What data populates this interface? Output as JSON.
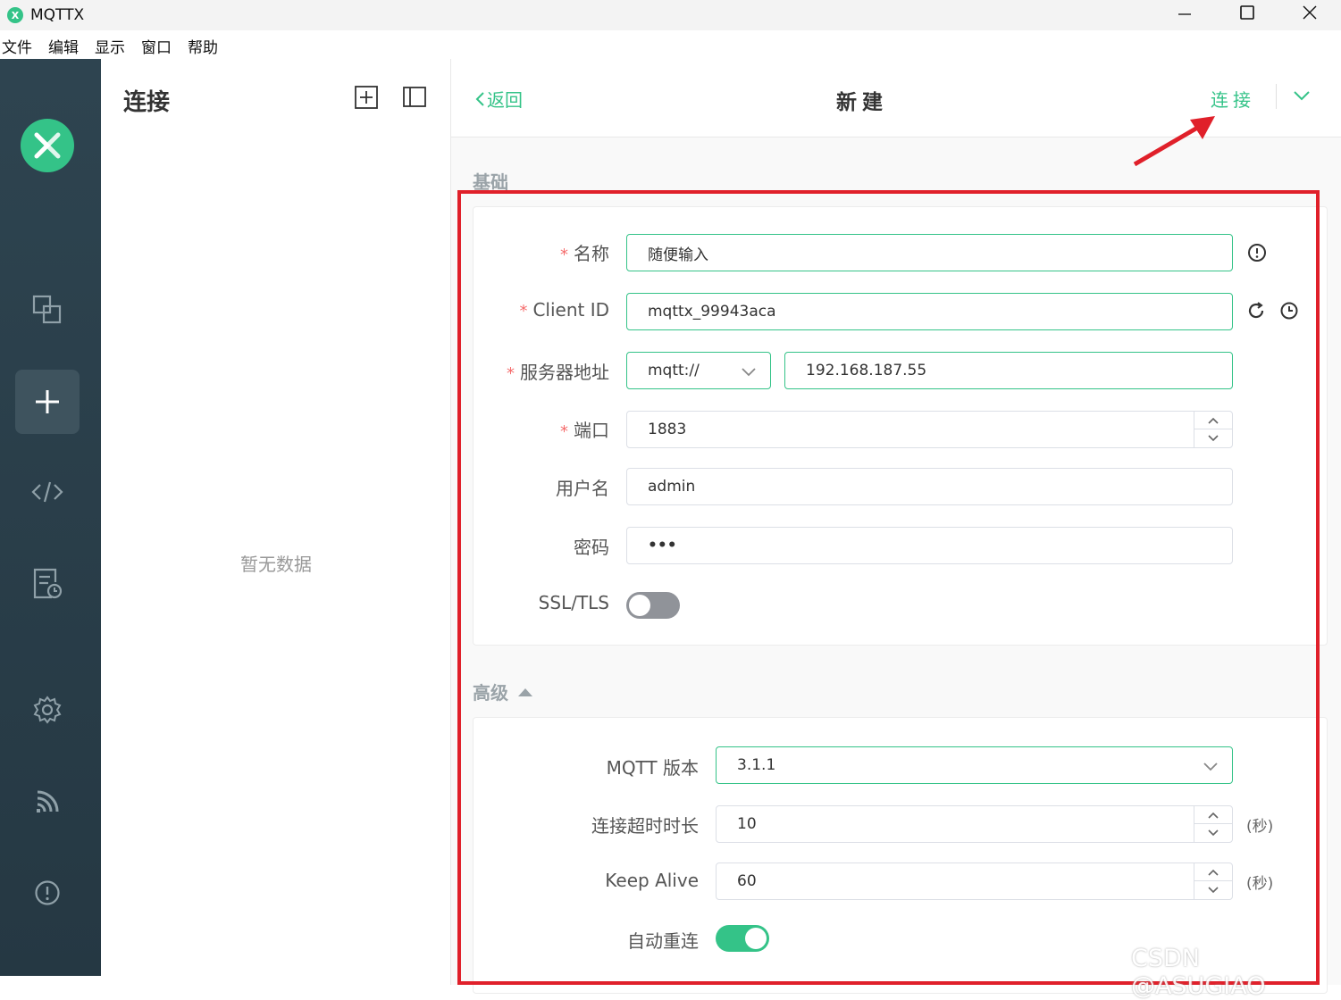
{
  "window": {
    "app_title": "MQTTX",
    "logo_glyph": "X",
    "minimize_icon": "minimize-icon",
    "maximize_icon": "maximize-icon",
    "close_icon": "close-icon"
  },
  "menu": [
    "文件",
    "编辑",
    "显示",
    "窗口",
    "帮助"
  ],
  "rail": {
    "items": [
      "connections-icon",
      "new-connection-icon",
      "script-icon",
      "log-icon",
      "settings-icon",
      "subscribe-icon",
      "about-icon"
    ],
    "active": "new-connection-icon"
  },
  "list_panel": {
    "title": "连接",
    "empty_text": "暂无数据"
  },
  "header": {
    "back_label": "返回",
    "title": "新建",
    "connect_label": "连接"
  },
  "basic": {
    "section_label": "基础",
    "name": {
      "label": "名称",
      "value": "随便输入",
      "required": true
    },
    "client_id": {
      "label": "Client ID",
      "value": "mqttx_99943aca",
      "required": true
    },
    "server": {
      "label": "服务器地址",
      "protocol": "mqtt://",
      "host": "192.168.187.55",
      "required": true
    },
    "port": {
      "label": "端口",
      "value": "1883",
      "required": true
    },
    "username": {
      "label": "用户名",
      "value": "admin"
    },
    "password": {
      "label": "密码",
      "value": "•••"
    },
    "ssl": {
      "label": "SSL/TLS",
      "enabled": false
    }
  },
  "advanced": {
    "section_label": "高级",
    "mqtt_version": {
      "label": "MQTT 版本",
      "value": "3.1.1"
    },
    "connect_timeout": {
      "label": "连接超时时长",
      "value": "10",
      "unit": "(秒)"
    },
    "keep_alive": {
      "label": "Keep Alive",
      "value": "60",
      "unit": "(秒)"
    },
    "auto_reconnect": {
      "label": "自动重连",
      "enabled": true
    }
  },
  "watermark": "CSDN @ASUGIAO",
  "colors": {
    "accent": "#34c388",
    "rail": "#2e4450",
    "annotation": "#e0202a",
    "required": "#f56c6c"
  }
}
